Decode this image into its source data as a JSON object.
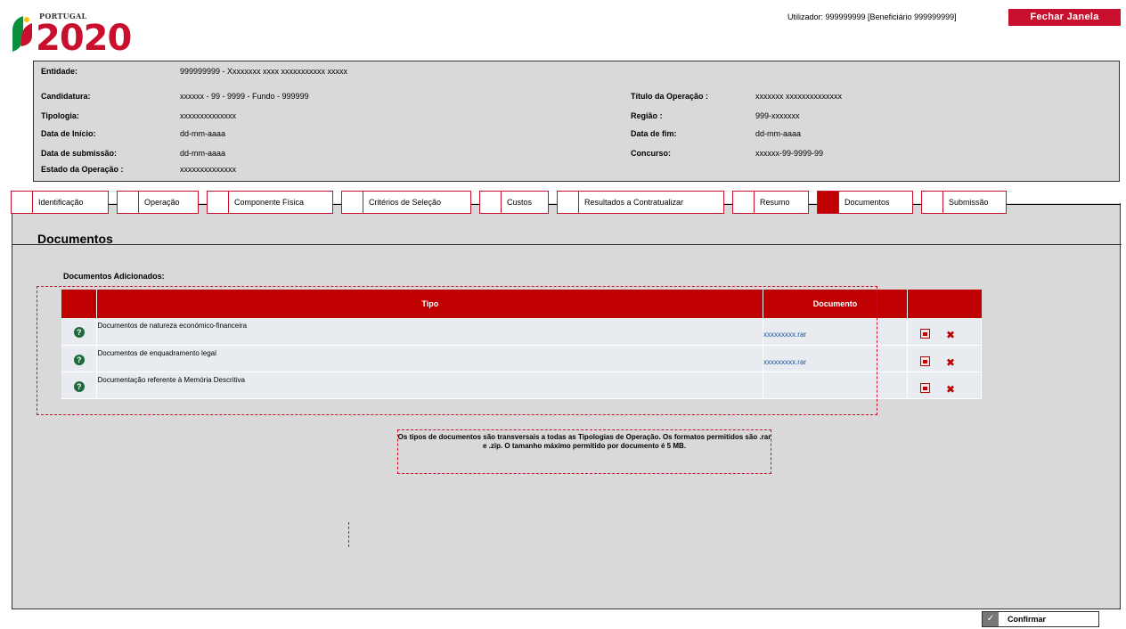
{
  "logo": {
    "country": "PORTUGAL",
    "year": "2020"
  },
  "header": {
    "user_text": "Utilizador:  999999999 [Beneficiário 999999999]",
    "close_label": "Fechar Janela"
  },
  "info": {
    "entidade_label": "Entidade:",
    "entidade_value": "999999999  - Xxxxxxxx xxxx xxxxxxxxxxx  xxxxx",
    "candidatura_label": "Candidatura:",
    "candidatura_value": "xxxxxx - 99 - 9999 - Fundo - 999999",
    "tipologia_label": "Tipologia:",
    "tipologia_value": "xxxxxxxxxxxxxx",
    "data_inicio_label": "Data de Início:",
    "data_inicio_value": "dd-mm-aaaa",
    "data_submissao_label": "Data de submissão:",
    "data_submissao_value": "dd-mm-aaaa",
    "estado_label": "Estado da Operação :",
    "estado_value": "xxxxxxxxxxxxxx",
    "titulo_label": "Título da Operação :",
    "titulo_value": "xxxxxxx xxxxxxxxxxxxxx",
    "regiao_label": "Região :",
    "regiao_value": "999-xxxxxxx",
    "data_fim_label": "Data de fim:",
    "data_fim_value": "dd-mm-aaaa",
    "concurso_label": "Concurso:",
    "concurso_value": "xxxxxx-99-9999-99"
  },
  "tabs": [
    {
      "label": "Identificação"
    },
    {
      "label": "Operação"
    },
    {
      "label": "Componente Física"
    },
    {
      "label": "Critérios de Seleção"
    },
    {
      "label": "Custos"
    },
    {
      "label": "Resultados a Contratualizar"
    },
    {
      "label": "Resumo"
    },
    {
      "label": "Documentos"
    },
    {
      "label": "Submissão"
    }
  ],
  "active_tab": "Documentos",
  "main": {
    "title": "Documentos",
    "section_label": "Documentos Adicionados:",
    "columns": {
      "tipo": "Tipo",
      "documento": "Documento"
    },
    "rows": [
      {
        "tipo": "Documentos de natureza  económico-financeira",
        "documento": "xxxxxxxxx.rar"
      },
      {
        "tipo": "Documentos de enquadramento  legal",
        "documento": "xxxxxxxxx.rar"
      },
      {
        "tipo": "Documentação referente  à Memória Descritiva",
        "documento": ""
      }
    ],
    "note": "Os tipos de documentos são transversais a todas as Tipologias de Operação. Os formatos permitidos são .rar e .zip. O tamanho máximo permitido por documento é 5 MB."
  },
  "confirm_label": "Confirmar",
  "colors": {
    "brand_red": "#c8102e",
    "header_red": "#c00000",
    "panel_gray": "#d9d9d9"
  }
}
